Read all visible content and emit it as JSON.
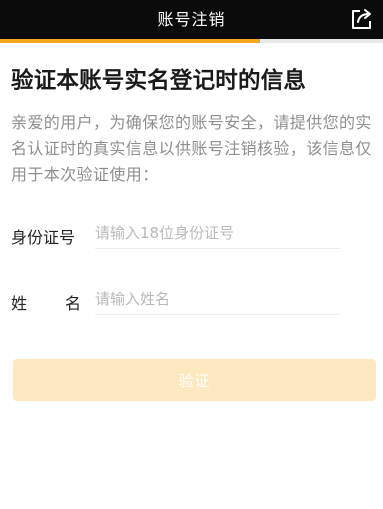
{
  "header": {
    "title": "账号注销",
    "share_icon": "share-icon",
    "background": "#0b0b0b"
  },
  "progress": {
    "fraction": 0.68,
    "color": "#f5a623"
  },
  "main": {
    "headline": "验证本账号实名登记时的信息",
    "intro": "亲爱的用户，为确保您的账号安全，请提供您的实名认证时的真实信息以供账号注销核验，该信息仅用于本次验证使用：",
    "id_field": {
      "label": "身份证号",
      "placeholder": "请输入18位身份证号",
      "value": ""
    },
    "name_field": {
      "label_chars": [
        "姓",
        "名"
      ],
      "placeholder": "请输入姓名",
      "value": ""
    },
    "verify_button": {
      "label": "验证",
      "background": "#fde8bf"
    }
  }
}
